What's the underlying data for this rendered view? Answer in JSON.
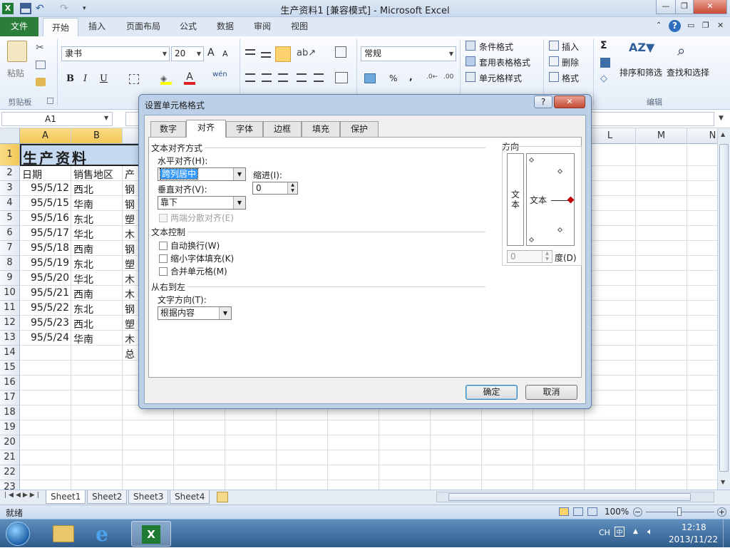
{
  "window": {
    "title": "生产资料1  [兼容模式] - Microsoft Excel",
    "app_icon": "excel-icon",
    "min_label": "—",
    "restore_label": "❐",
    "close_label": "✕"
  },
  "ribbon_tabs": [
    "文件",
    "开始",
    "插入",
    "页面布局",
    "公式",
    "数据",
    "审阅",
    "视图"
  ],
  "ribbon": {
    "clipboard": {
      "paste": "粘贴",
      "group": "剪贴板"
    },
    "font": {
      "name": "隶书",
      "size": "20",
      "bold": "B",
      "italic": "I",
      "underline": "U",
      "grow": "A",
      "shrink": "A",
      "wen": "wén"
    },
    "number": {
      "format": "常规",
      "percent": "%",
      "comma": ","
    },
    "styles": {
      "conditional": "条件格式",
      "table": "套用表格格式",
      "cell": "单元格样式"
    },
    "cells": {
      "insert": "插入",
      "delete": "删除",
      "format": "格式"
    },
    "editing": {
      "sort": "排序和筛选",
      "find": "查找和选择",
      "group": "编辑",
      "sum": "Σ"
    }
  },
  "namebox": {
    "value": "A1"
  },
  "sheet": {
    "columns": [
      "A",
      "B",
      "",
      "",
      "",
      "",
      "",
      "",
      "",
      "",
      "",
      "L",
      "M",
      "N"
    ],
    "rows": [
      "1",
      "2",
      "3",
      "4",
      "5",
      "6",
      "7",
      "8",
      "9",
      "10",
      "11",
      "12",
      "13",
      "14",
      "15",
      "16",
      "17",
      "18",
      "19",
      "20",
      "21",
      "22",
      "23"
    ],
    "title": "生产资料",
    "headers": [
      "日期",
      "销售地区",
      "产"
    ],
    "data": [
      [
        "95/5/12",
        "西北",
        "钢"
      ],
      [
        "95/5/15",
        "华南",
        "钢"
      ],
      [
        "95/5/16",
        "东北",
        "塑"
      ],
      [
        "95/5/17",
        "华北",
        "木"
      ],
      [
        "95/5/18",
        "西南",
        "钢"
      ],
      [
        "95/5/19",
        "东北",
        "塑"
      ],
      [
        "95/5/20",
        "华北",
        "木"
      ],
      [
        "95/5/21",
        "西南",
        "木"
      ],
      [
        "95/5/22",
        "东北",
        "钢"
      ],
      [
        "95/5/23",
        "西北",
        "塑"
      ],
      [
        "95/5/24",
        "华南",
        "木"
      ]
    ],
    "total_label": "总"
  },
  "sheet_tabs": [
    "Sheet1",
    "Sheet2",
    "Sheet3",
    "Sheet4"
  ],
  "status": {
    "ready": "就绪",
    "zoom": "100%"
  },
  "taskbar": {
    "lang": "CH",
    "time": "12:18",
    "date": "2013/11/22"
  },
  "dialog": {
    "title": "设置单元格格式",
    "help": "?",
    "close": "✕",
    "tabs": [
      "数字",
      "对齐",
      "字体",
      "边框",
      "填充",
      "保护"
    ],
    "active_tab": "对齐",
    "text_alignment": {
      "section": "文本对齐方式",
      "horizontal_label": "水平对齐(H):",
      "horizontal_value": "跨列居中",
      "vertical_label": "垂直对齐(V):",
      "vertical_value": "靠下",
      "indent_label": "缩进(I):",
      "indent_value": "0",
      "justify_distributed": "两端分散对齐(E)"
    },
    "text_control": {
      "section": "文本控制",
      "wrap": "自动换行(W)",
      "shrink": "缩小字体填充(K)",
      "merge": "合并单元格(M)"
    },
    "rtl": {
      "section": "从右到左",
      "direction_label": "文字方向(T):",
      "direction_value": "根据内容"
    },
    "orientation": {
      "section": "方向",
      "vertical_text": "文本",
      "horizontal_text": "文本",
      "degrees_value": "0",
      "degrees_label": "度(D)"
    },
    "ok": "确定",
    "cancel": "取消"
  }
}
